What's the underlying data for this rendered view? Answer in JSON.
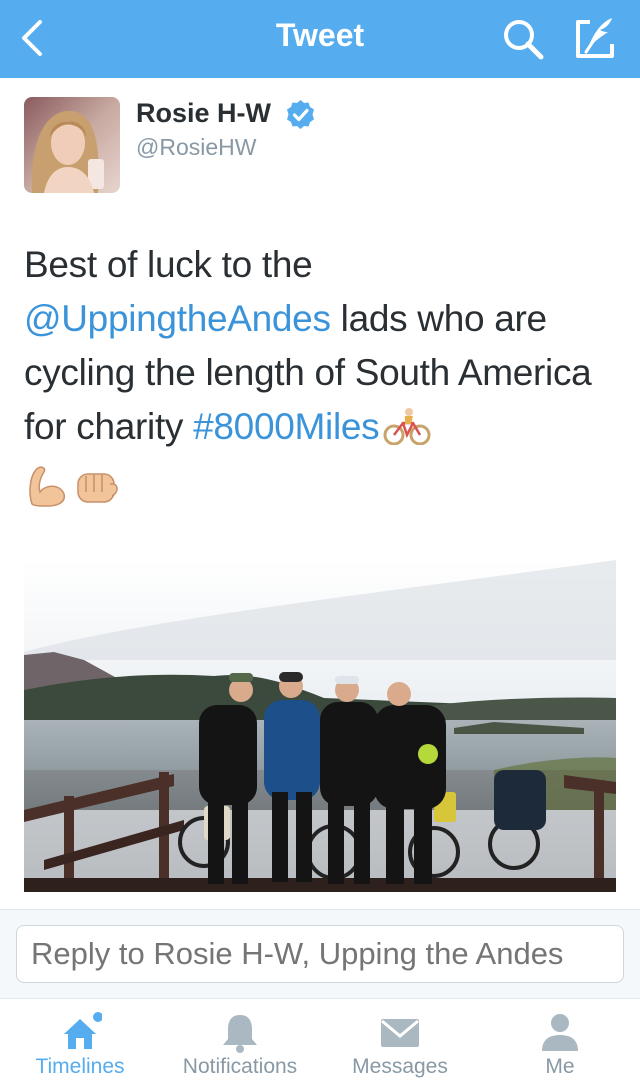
{
  "nav": {
    "title": "Tweet",
    "back_icon": "chevron-left-icon",
    "search_icon": "search-icon",
    "compose_icon": "compose-icon"
  },
  "tweet": {
    "display_name": "Rosie H-W",
    "handle": "@RosieHW",
    "verified": true,
    "text_parts": {
      "p1": "Best of luck to the ",
      "mention": "@UppingtheAndes",
      "p2": " lads who are cycling the length of South America for charity ",
      "hashtag": "#8000Miles"
    },
    "emojis": [
      "bicyclist",
      "flexed-biceps",
      "fisted-hand"
    ]
  },
  "reply": {
    "placeholder": "Reply to Rosie H-W, Upping the Andes"
  },
  "tabs": [
    {
      "label": "Timelines",
      "icon": "home-icon",
      "active": true,
      "has_dot": true
    },
    {
      "label": "Notifications",
      "icon": "bell-icon",
      "active": false
    },
    {
      "label": "Messages",
      "icon": "envelope-icon",
      "active": false
    },
    {
      "label": "Me",
      "icon": "person-icon",
      "active": false
    }
  ],
  "colors": {
    "brand": "#55acee",
    "link": "#3b94d9",
    "muted": "#8899a6",
    "text": "#292f33",
    "verified": "#55acee"
  }
}
